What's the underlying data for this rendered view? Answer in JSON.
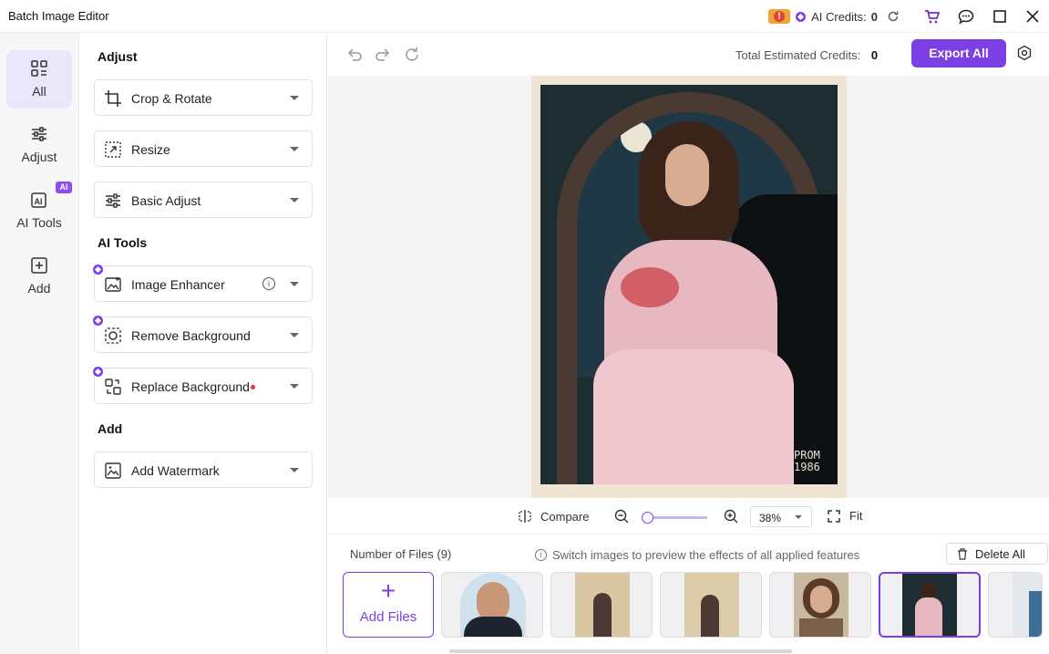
{
  "window": {
    "title": "Batch Image Editor"
  },
  "titlebar": {
    "credits_label": "AI Credits:",
    "credits_value": "0"
  },
  "nav": {
    "items": [
      {
        "label": "All"
      },
      {
        "label": "Adjust"
      },
      {
        "label": "AI Tools"
      },
      {
        "label": "Add"
      }
    ],
    "ai_badge": "AI"
  },
  "panel": {
    "sections": {
      "adjust": "Adjust",
      "ai_tools": "AI Tools",
      "add": "Add"
    },
    "tools": {
      "crop": "Crop & Rotate",
      "resize": "Resize",
      "basic_adjust": "Basic Adjust",
      "image_enhancer": "Image Enhancer",
      "remove_background": "Remove Background",
      "replace_background": "Replace Background",
      "add_watermark": "Add Watermark"
    }
  },
  "toolbar": {
    "estimate_label": "Total Estimated Credits:",
    "estimate_value": "0",
    "export_label": "Export All"
  },
  "preview": {
    "photo_caption": "PROM\n1986"
  },
  "viewbar": {
    "compare_label": "Compare",
    "zoom_value": "38%",
    "zoom_level": 0.0,
    "fit_label": "Fit"
  },
  "files": {
    "count_label": "Number of Files (9)",
    "hint": "Switch images to preview the effects of all applied features",
    "delete_all_label": "Delete All",
    "add_files_label": "Add Files"
  },
  "colors": {
    "accent": "#7b3fe4",
    "accent_light": "#ebe7fb"
  }
}
